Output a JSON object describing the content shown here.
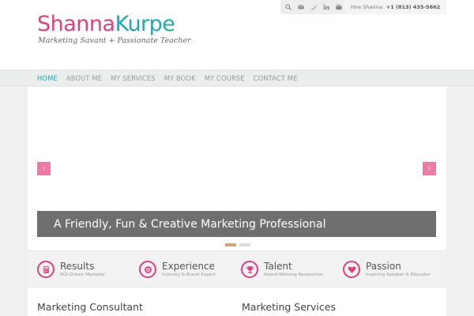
{
  "logo": {
    "first": "Shanna",
    "last": "Kurpe",
    "tagline": "Marketing Savant + Passionate Teacher"
  },
  "topbar": {
    "icons": [
      "search-icon",
      "email-icon",
      "twitter-icon",
      "linkedin-icon",
      "youtube-icon"
    ],
    "hire_label": "Hire Shanna:",
    "phone": "+1 (813) 435-5662"
  },
  "nav": {
    "items": [
      {
        "label": "HOME",
        "active": true
      },
      {
        "label": "ABOUT ME",
        "active": false
      },
      {
        "label": "MY SERVICES",
        "active": false
      },
      {
        "label": "MY BOOK",
        "active": false
      },
      {
        "label": "MY COURSE",
        "active": false
      },
      {
        "label": "CONTACT ME",
        "active": false
      }
    ]
  },
  "slider": {
    "caption": "A Friendly, Fun & Creative Marketing Professional",
    "prev": "‹",
    "next": "›",
    "slide_count": 2,
    "active_slide": 1
  },
  "features": [
    {
      "title": "Results",
      "subtitle": "ROI-Driven Marketer",
      "icon": "calculator-icon"
    },
    {
      "title": "Experience",
      "subtitle": "Industry & Brand Expert",
      "icon": "medal-icon"
    },
    {
      "title": "Talent",
      "subtitle": "Award-Winning Researcher",
      "icon": "trophy-icon"
    },
    {
      "title": "Passion",
      "subtitle": "Inspiring Speaker & Educator",
      "icon": "heart-icon"
    }
  ],
  "sections": {
    "left": "Marketing Consultant",
    "right": "Marketing Services"
  },
  "colors": {
    "pink": "#e0407d",
    "teal": "#1ca8b4",
    "caption_bg": "#6f6f6f"
  }
}
